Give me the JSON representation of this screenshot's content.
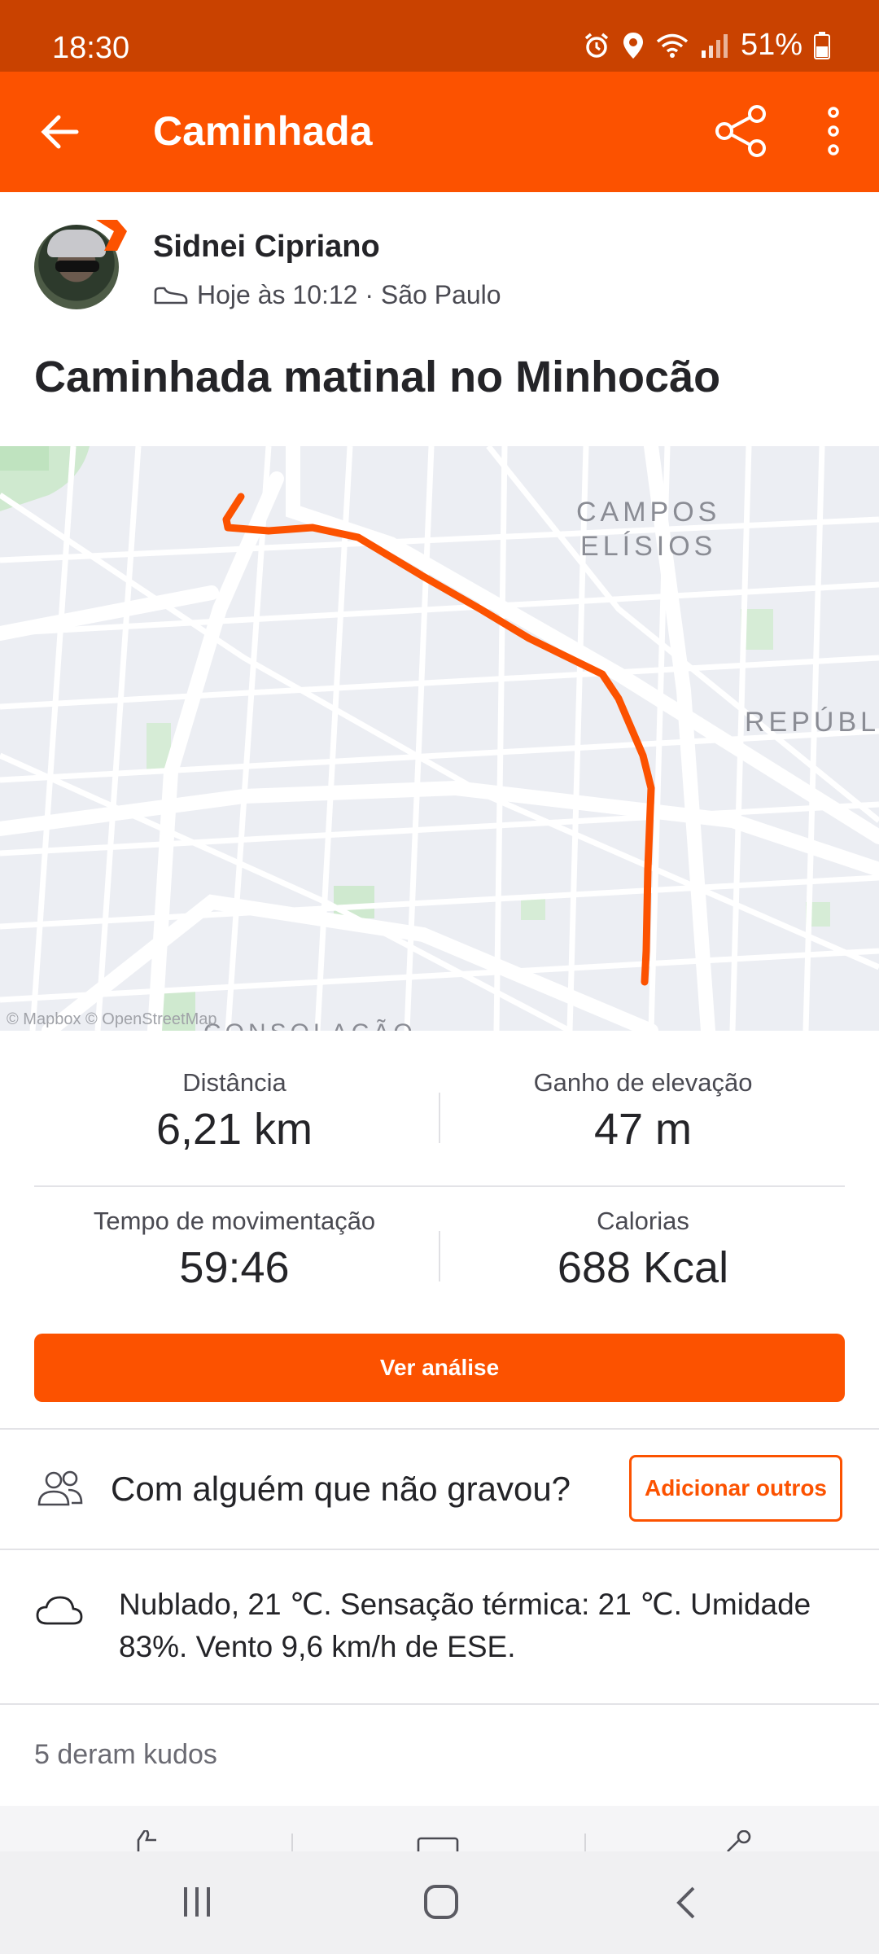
{
  "status_bar": {
    "time": "18:30",
    "battery": "51%"
  },
  "app_bar": {
    "title": "Caminhada"
  },
  "athlete": {
    "name": "Sidnei Cipriano",
    "meta": "Hoje às 10:12 · São Paulo"
  },
  "activity": {
    "title": "Caminhada matinal no Minhocão"
  },
  "map": {
    "labels": {
      "campos": "CAMPOS",
      "elisios": "ELÍSIOS",
      "republica": "REPÚBLI",
      "consolacao": "CONSOLAÇÃO"
    },
    "attribution": "© Mapbox © OpenStreetMap",
    "route_color": "#fc5200"
  },
  "stats": {
    "distance": {
      "label": "Distância",
      "value": "6,21 km"
    },
    "elevation": {
      "label": "Ganho de elevação",
      "value": "47 m"
    },
    "moving_time": {
      "label": "Tempo de movimentação",
      "value": "59:46"
    },
    "calories": {
      "label": "Calorias",
      "value": "688 Kcal"
    }
  },
  "analysis_button": "Ver análise",
  "group": {
    "question": "Com alguém que não gravou?",
    "add_button": "Adicionar outros"
  },
  "weather": {
    "text": "Nublado, 21 ℃. Sensação térmica: 21 ℃. Umidade 83%. Vento 9,6 km/h de ESE."
  },
  "kudos": {
    "text": "5 deram kudos"
  },
  "colors": {
    "brand": "#fc5200",
    "status_bar": "#c94200"
  }
}
